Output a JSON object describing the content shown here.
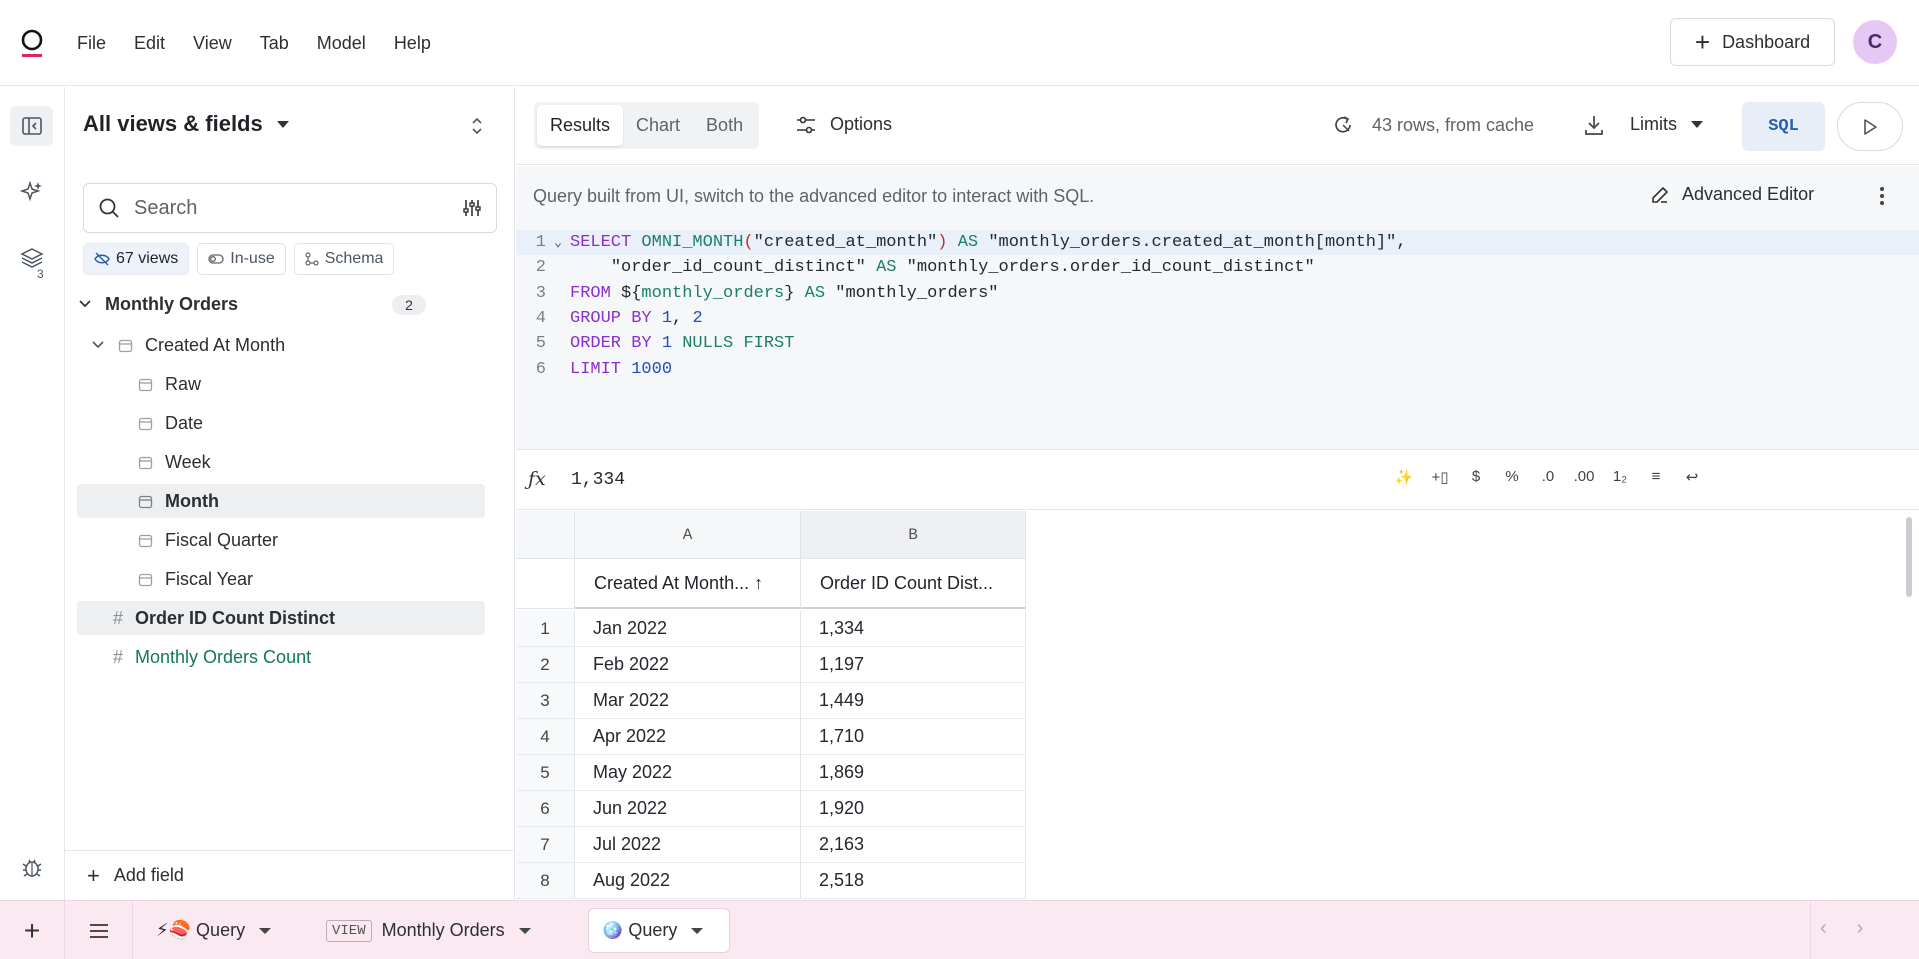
{
  "menu": [
    "File",
    "Edit",
    "View",
    "Tab",
    "Model",
    "Help"
  ],
  "header": {
    "dashboard_label": "Dashboard",
    "avatar_initial": "C"
  },
  "rail": {
    "layers_badge": "3"
  },
  "sidebar": {
    "title": "All views & fields",
    "search_placeholder": "Search",
    "chips": {
      "views": "67 views",
      "in_use": "In-use",
      "schema": "Schema"
    },
    "group": {
      "label": "Monthly Orders",
      "count": "2"
    },
    "dimension": "Created At Month",
    "timeframes": [
      "Raw",
      "Date",
      "Week",
      "Month",
      "Fiscal Quarter",
      "Fiscal Year"
    ],
    "measures": [
      "Order ID Count Distinct",
      "Monthly Orders Count"
    ],
    "add_field": "Add field"
  },
  "toolbar": {
    "tabs": [
      "Results",
      "Chart",
      "Both"
    ],
    "options": "Options",
    "rows_info": "43 rows, from cache",
    "limits": "Limits",
    "sql": "SQL"
  },
  "editor": {
    "note": "Query built from UI, switch to the advanced editor to interact with SQL.",
    "advanced_label": "Advanced Editor",
    "line_numbers": [
      "1",
      "2",
      "3",
      "4",
      "5",
      "6"
    ],
    "tokens": {
      "select": "SELECT",
      "omni_month": "OMNI_MONTH",
      "open_paren": "(",
      "close_paren": ")",
      "created_at_month": "\"created_at_month\"",
      "as": "AS",
      "alias1": "\"monthly_orders.created_at_month[month]\"",
      "comma": ",",
      "order_id_col": "\"order_id_count_distinct\"",
      "alias2": "\"monthly_orders.order_id_count_distinct\"",
      "from": "FROM",
      "dollar_open": "${",
      "view_ref": "monthly_orders",
      "close_brace": "}",
      "alias3": "\"monthly_orders\"",
      "group_by": "GROUP BY",
      "one": "1",
      "two": "2",
      "order_by": "ORDER BY",
      "nulls_first": "NULLS FIRST",
      "limit": "LIMIT",
      "limit_val": "1000"
    }
  },
  "formula": {
    "value": "1,334"
  },
  "grid": {
    "column_letters": [
      "A",
      "B"
    ],
    "headers": [
      "Created At Month... ↑",
      "Order ID Count Dist..."
    ],
    "rows": [
      {
        "n": "1",
        "month": "Jan 2022",
        "count": "1,334"
      },
      {
        "n": "2",
        "month": "Feb 2022",
        "count": "1,197"
      },
      {
        "n": "3",
        "month": "Mar 2022",
        "count": "1,449"
      },
      {
        "n": "4",
        "month": "Apr 2022",
        "count": "1,710"
      },
      {
        "n": "5",
        "month": "May 2022",
        "count": "1,869"
      },
      {
        "n": "6",
        "month": "Jun 2022",
        "count": "1,920"
      },
      {
        "n": "7",
        "month": "Jul 2022",
        "count": "2,163"
      },
      {
        "n": "8",
        "month": "Aug 2022",
        "count": "2,518"
      }
    ]
  },
  "tabbar": {
    "tab1": "⚡🍣 Query",
    "view_tag": "VIEW",
    "tab2": "Monthly Orders",
    "tab3": "🪩 Query"
  }
}
